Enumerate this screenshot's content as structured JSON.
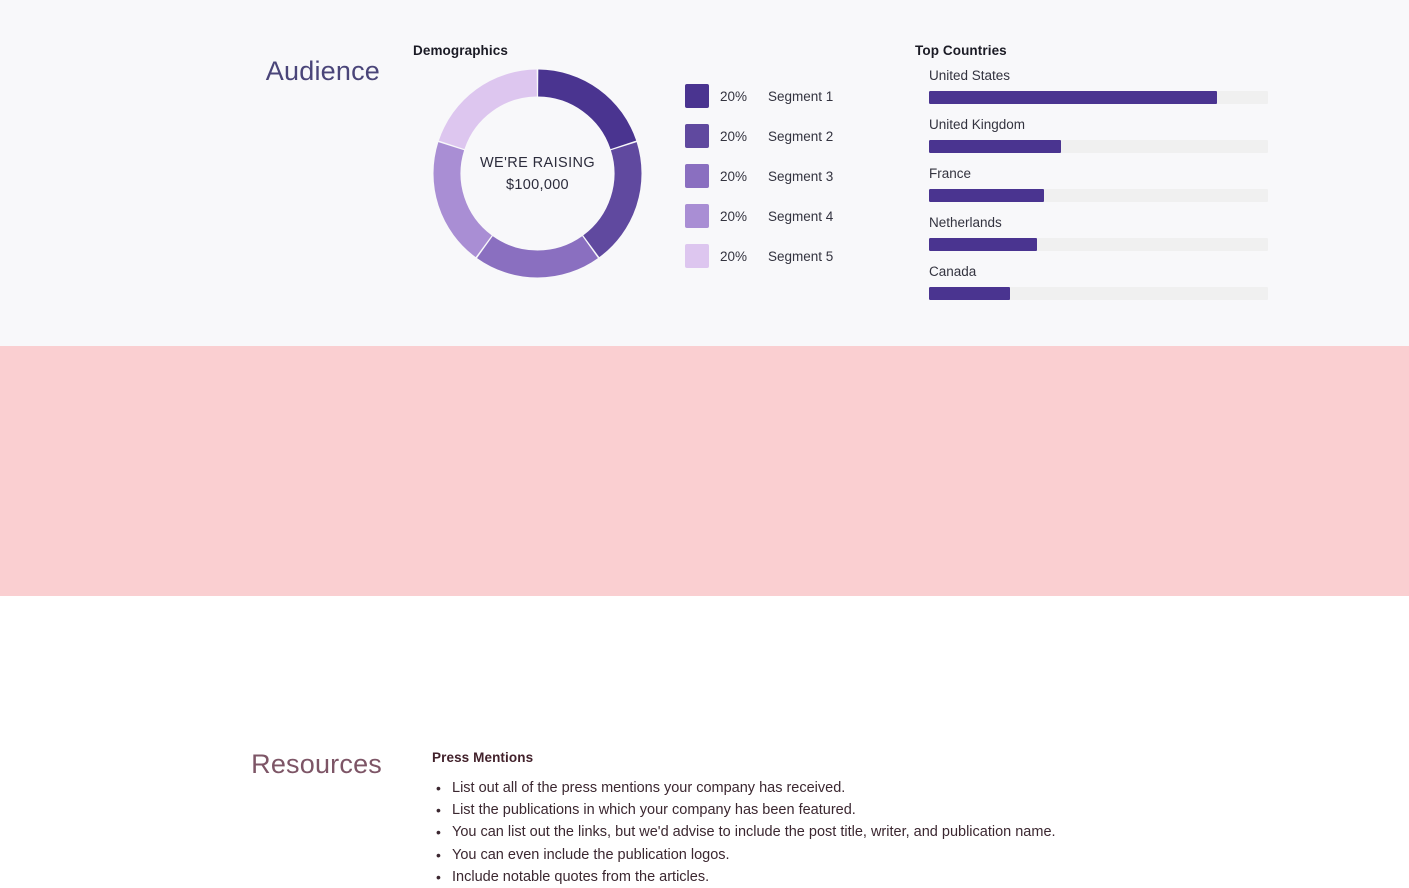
{
  "theme": {
    "audience_bg": "#f8f8fa",
    "resources_bg": "#facfd1",
    "audience_heading_color": "#4a4579",
    "resources_heading_color": "#7d5566",
    "bar_fill_color": "#4a3490",
    "bar_track_color": "#f0f0f0",
    "body_text_color": "#33333f"
  },
  "audience": {
    "heading": "Audience",
    "demographics": {
      "heading": "Demographics",
      "center_line1": "WE'RE RAISING",
      "center_line2": "$100,000",
      "legend": [
        {
          "pct": "20%",
          "label": "Segment 1",
          "color": "#4a3490"
        },
        {
          "pct": "20%",
          "label": "Segment 2",
          "color": "#60499f"
        },
        {
          "pct": "20%",
          "label": "Segment 3",
          "color": "#8a6fc0"
        },
        {
          "pct": "20%",
          "label": "Segment 4",
          "color": "#a98ed4"
        },
        {
          "pct": "20%",
          "label": "Segment 5",
          "color": "#ddc6ef"
        }
      ]
    },
    "top_countries": {
      "heading": "Top Countries",
      "rows": [
        {
          "name": "United States",
          "value": 85
        },
        {
          "name": "United Kingdom",
          "value": 39
        },
        {
          "name": "France",
          "value": 34
        },
        {
          "name": "Netherlands",
          "value": 32
        },
        {
          "name": "Canada",
          "value": 24
        }
      ]
    }
  },
  "resources": {
    "heading": "Resources",
    "press_mentions": {
      "heading": "Press Mentions",
      "items": [
        "List out all of the press mentions your company has received.",
        "List the publications in which your company has been featured.",
        "You can list out the links, but we'd advise to include the post title, writer, and publication name.",
        "You can even include the publication logos.",
        "Include notable quotes from the articles."
      ]
    }
  },
  "chart_data": [
    {
      "type": "pie",
      "variant": "donut",
      "title": "Demographics",
      "center_text": [
        "WE'RE RAISING",
        "$100,000"
      ],
      "labels": [
        "Segment 1",
        "Segment 2",
        "Segment 3",
        "Segment 4",
        "Segment 5"
      ],
      "values": [
        20,
        20,
        20,
        20,
        20
      ],
      "unit": "%",
      "colors": [
        "#4a3490",
        "#60499f",
        "#8a6fc0",
        "#a98ed4",
        "#ddc6ef"
      ],
      "legend": "right",
      "start_angle_deg": 0,
      "direction": "clockwise"
    },
    {
      "type": "bar",
      "orientation": "horizontal",
      "title": "Top Countries",
      "categories": [
        "United States",
        "United Kingdom",
        "France",
        "Netherlands",
        "Canada"
      ],
      "values": [
        85,
        39,
        34,
        32,
        24
      ],
      "xlabel": "",
      "ylabel": "",
      "xlim": [
        0,
        100
      ],
      "grid": false,
      "bar_color": "#4a3490",
      "track_color": "#f0f0f0"
    }
  ]
}
